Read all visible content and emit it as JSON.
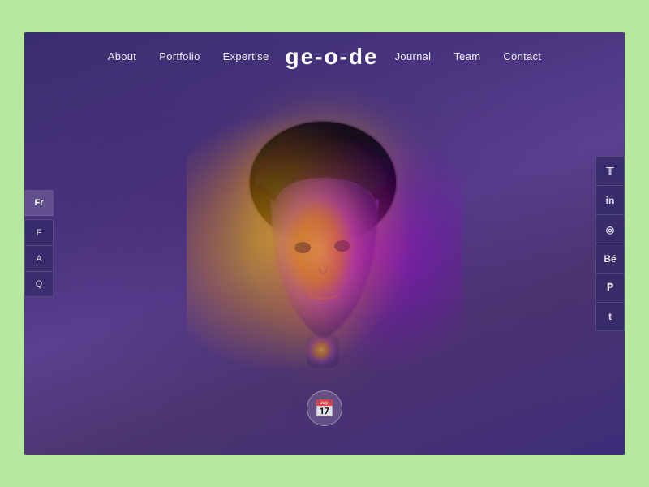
{
  "brand": {
    "logo": "ge-o-de"
  },
  "nav": {
    "items": [
      {
        "label": "About",
        "id": "about"
      },
      {
        "label": "Portfolio",
        "id": "portfolio"
      },
      {
        "label": "Expertise",
        "id": "expertise"
      },
      {
        "label": "Journal",
        "id": "journal"
      },
      {
        "label": "Team",
        "id": "team"
      },
      {
        "label": "Contact",
        "id": "contact"
      }
    ]
  },
  "left_sidebar": {
    "lang_button": "Fr",
    "faq_letters": [
      "F",
      "A",
      "Q"
    ]
  },
  "right_sidebar": {
    "social_icons": [
      {
        "name": "twitter",
        "symbol": "𝕋",
        "label": "Twitter"
      },
      {
        "name": "linkedin",
        "symbol": "in",
        "label": "LinkedIn"
      },
      {
        "name": "dribbble",
        "symbol": "◎",
        "label": "Dribbble"
      },
      {
        "name": "behance",
        "symbol": "Bé",
        "label": "Behance"
      },
      {
        "name": "pinterest",
        "symbol": "𝐏",
        "label": "Pinterest"
      },
      {
        "name": "tumblr",
        "symbol": "t",
        "label": "Tumblr"
      }
    ]
  },
  "calendar_button": {
    "label": "📅",
    "aria_label": "Schedule"
  }
}
